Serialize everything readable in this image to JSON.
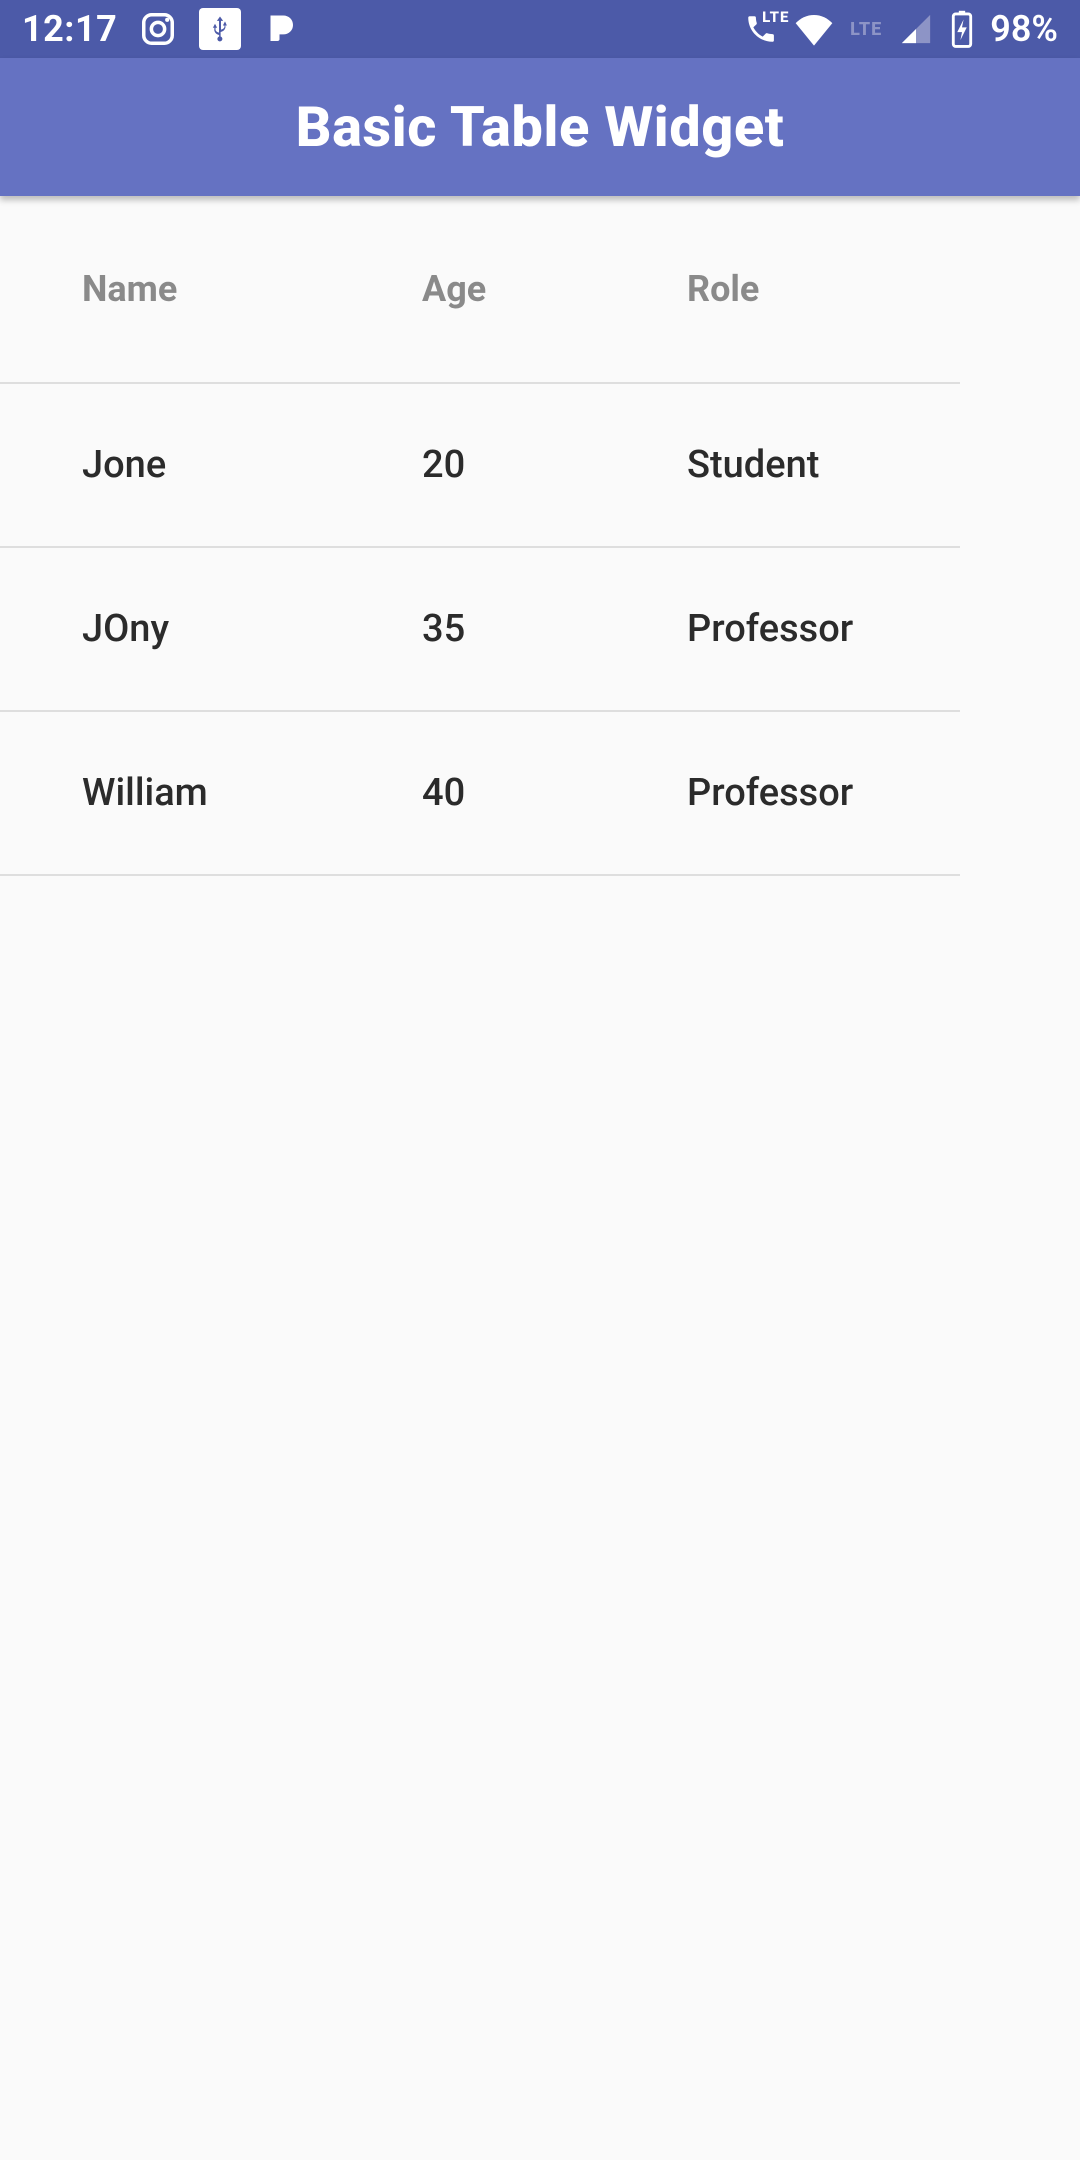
{
  "statusbar": {
    "time": "12:17",
    "battery_percent": "98%",
    "lte_label": "LTE"
  },
  "appbar": {
    "title": "Basic Table Widget"
  },
  "table": {
    "headers": {
      "name": "Name",
      "age": "Age",
      "role": "Role"
    },
    "rows": [
      {
        "name": "Jone",
        "age": "20",
        "role": "Student"
      },
      {
        "name": "JOny",
        "age": "35",
        "role": "Professor"
      },
      {
        "name": "William",
        "age": "40",
        "role": "Professor"
      }
    ]
  }
}
